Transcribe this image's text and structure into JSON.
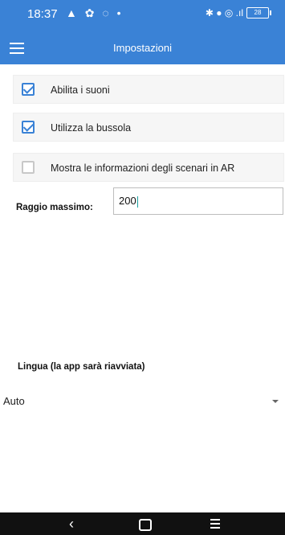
{
  "status_bar": {
    "time": "18:37",
    "left_icons": "▲ ✿ ◌ •",
    "right_icons": "✱ ● ◎ .ıl",
    "battery": "28"
  },
  "app_bar": {
    "title": "Impostazioni",
    "menu_icon": "hamburger-icon"
  },
  "settings": {
    "options": [
      {
        "label": "Abilita i suoni",
        "checked": true
      },
      {
        "label": "Utilizza la bussola",
        "checked": true
      },
      {
        "label": "Mostra le informazioni degli scenari in AR",
        "checked": false
      }
    ],
    "raggio": {
      "label": "Raggio massimo:",
      "value": "200"
    },
    "lingua": {
      "label": "Lingua (la app sarà riavviata)",
      "selected": "Auto"
    }
  },
  "nav_bar": {
    "back_icon": "back-icon",
    "home_icon": "home-icon",
    "recent_icon": "recent-apps-icon",
    "back_glyph": "‹"
  },
  "colors": {
    "accent": "#3a82d6",
    "navbar": "#111111"
  }
}
